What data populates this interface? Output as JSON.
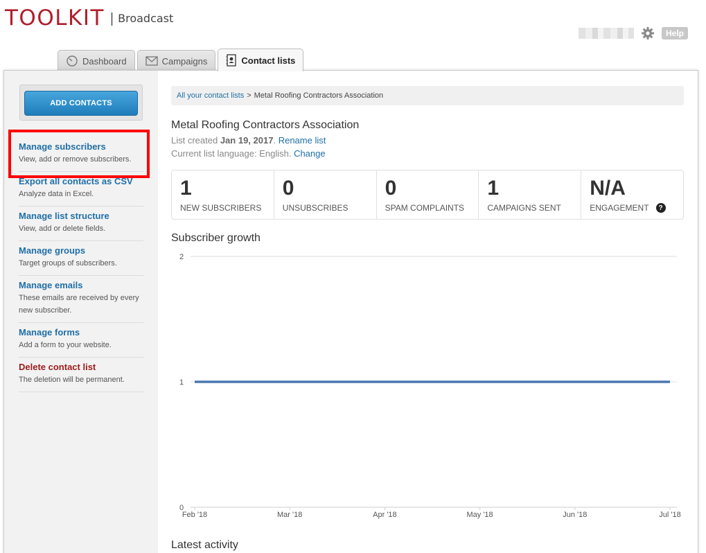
{
  "header": {
    "logo": "TOOLKIT",
    "separator": "|",
    "product": "Broadcast",
    "help_label": "Help"
  },
  "tabs": [
    {
      "label": "Dashboard",
      "icon": "dashboard-gauge-icon"
    },
    {
      "label": "Campaigns",
      "icon": "envelope-icon"
    },
    {
      "label": "Contact lists",
      "icon": "contact-book-icon",
      "active": true
    }
  ],
  "sidebar": {
    "add_button": "ADD CONTACTS",
    "items": [
      {
        "title": "Manage subscribers",
        "desc": "View, add or remove subscribers."
      },
      {
        "title": "Export all contacts as CSV",
        "desc": "Analyze data in Excel."
      },
      {
        "title": "Manage list structure",
        "desc": "View, add or delete fields."
      },
      {
        "title": "Manage groups",
        "desc": "Target groups of subscribers."
      },
      {
        "title": "Manage emails",
        "desc": "These emails are received by every new subscriber."
      },
      {
        "title": "Manage forms",
        "desc": "Add a form to your website."
      },
      {
        "title": "Delete contact list",
        "desc": "The deletion will be permanent."
      }
    ]
  },
  "breadcrumb": {
    "link": "All your contact lists",
    "separator": ">",
    "current": "Metal Roofing Contractors Association"
  },
  "list": {
    "title": "Metal Roofing Contractors Association",
    "created_prefix": "List created",
    "created_date": "Jan 19, 2017",
    "rename_link": "Rename list",
    "language_text": "Current list language: English.",
    "change_link": "Change"
  },
  "stats": [
    {
      "value": "1",
      "label": "NEW SUBSCRIBERS"
    },
    {
      "value": "0",
      "label": "UNSUBSCRIBES"
    },
    {
      "value": "0",
      "label": "SPAM COMPLAINTS"
    },
    {
      "value": "1",
      "label": "CAMPAIGNS SENT"
    },
    {
      "value": "N/A",
      "label": "ENGAGEMENT"
    }
  ],
  "growth_title": "Subscriber growth",
  "latest_title": "Latest activity",
  "colors": {
    "line": "#4a78b0",
    "accent": "#1f6fa7",
    "brand": "#b01e2a"
  },
  "chart_data": {
    "type": "line",
    "x": [
      "Feb '18",
      "Mar '18",
      "Apr '18",
      "May '18",
      "Jun '18",
      "Jul '18"
    ],
    "y_ticks": [
      "0",
      "1",
      "2"
    ],
    "ylim": [
      0,
      2
    ],
    "series": [
      {
        "values": [
          1,
          1,
          1,
          1,
          1,
          1
        ]
      }
    ],
    "grid": true
  }
}
